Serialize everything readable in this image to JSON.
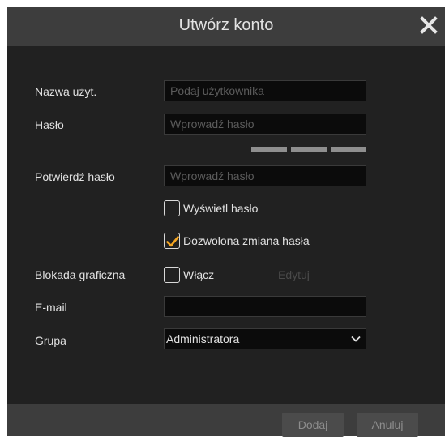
{
  "dialog": {
    "title": "Utwórz konto",
    "close_icon": "close-icon"
  },
  "form": {
    "username": {
      "label": "Nazwa użyt.",
      "placeholder": "Podaj użytkownika",
      "value": ""
    },
    "password": {
      "label": "Hasło",
      "placeholder": "Wprowadź hasło",
      "value": ""
    },
    "password_strength_segments": 3,
    "confirm_password": {
      "label": "Potwierdź hasło",
      "placeholder": "Wprowadź hasło",
      "value": ""
    },
    "show_password": {
      "label": "Wyświetl hasło",
      "checked": false
    },
    "allow_password_change": {
      "label": "Dozwolona zmiana hasła",
      "checked": true
    },
    "pattern_lock": {
      "label": "Blokada graficzna",
      "enable_label": "Włącz",
      "checked": false,
      "edit_label": "Edytuj"
    },
    "email": {
      "label": "E-mail",
      "value": ""
    },
    "group": {
      "label": "Grupa",
      "selected": "Administratora"
    }
  },
  "footer": {
    "add_label": "Dodaj",
    "cancel_label": "Anuluj"
  },
  "colors": {
    "background": "#212121",
    "bar": "#3d3d3d",
    "checkmark": "#f5a623",
    "text": "#e1e1e1",
    "placeholder": "#5b5b5b"
  }
}
